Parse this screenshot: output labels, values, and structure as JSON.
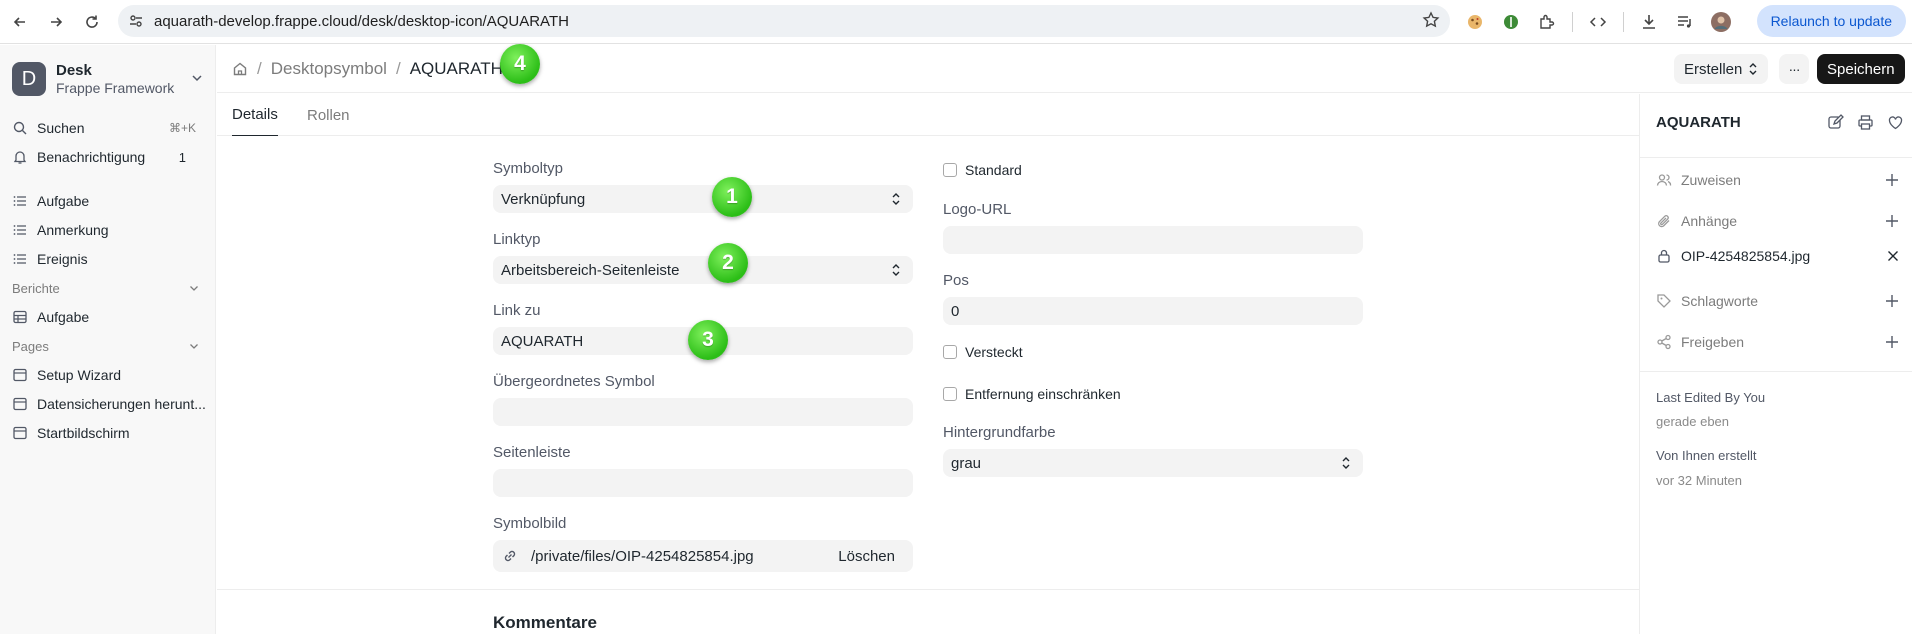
{
  "browser": {
    "url": "aquarath-develop.frappe.cloud/desk/desktop-icon/AQUARATH",
    "relaunch_label": "Relaunch to update"
  },
  "sidebar": {
    "workspace_initial": "D",
    "workspace_title": "Desk",
    "workspace_subtitle": "Frappe Framework",
    "search_label": "Suchen",
    "search_shortcut": "⌘+K",
    "notifications_label": "Benachrichtigung",
    "notifications_count": "1",
    "items": [
      {
        "label": "Aufgabe"
      },
      {
        "label": "Anmerkung"
      },
      {
        "label": "Ereignis"
      }
    ],
    "reports_section": "Berichte",
    "reports": [
      {
        "label": "Aufgabe"
      }
    ],
    "pages_section": "Pages",
    "pages": [
      {
        "label": "Setup Wizard"
      },
      {
        "label": "Datensicherungen herunt..."
      },
      {
        "label": "Startbildschirm"
      }
    ]
  },
  "header": {
    "breadcrumb_parent": "Desktopsymbol",
    "breadcrumb_current": "AQUARATH",
    "create_label": "Erstellen",
    "more_label": "···",
    "save_label": "Speichern"
  },
  "annotations": [
    "1",
    "2",
    "3",
    "4"
  ],
  "tabs": [
    {
      "label": "Details",
      "active": true
    },
    {
      "label": "Rollen",
      "active": false
    }
  ],
  "form": {
    "symboltyp_label": "Symboltyp",
    "symboltyp_value": "Verknüpfung",
    "linktyp_label": "Linktyp",
    "linktyp_value": "Arbeitsbereich-Seitenleiste",
    "linkzu_label": "Link zu",
    "linkzu_value": "AQUARATH",
    "parent_label": "Übergeordnetes Symbol",
    "parent_value": "",
    "sidebar_label": "Seitenleiste",
    "sidebar_value": "",
    "image_label": "Symbolbild",
    "image_value": "/private/files/OIP-4254825854.jpg",
    "image_delete": "Löschen",
    "standard_label": "Standard",
    "logo_label": "Logo-URL",
    "logo_value": "",
    "pos_label": "Pos",
    "pos_value": "0",
    "hidden_label": "Versteckt",
    "restrict_label": "Entfernung einschränken",
    "bg_label": "Hintergrundfarbe",
    "bg_value": "grau"
  },
  "comments_title": "Kommentare",
  "right_panel": {
    "title": "AQUARATH",
    "assign_label": "Zuweisen",
    "attachments_label": "Anhänge",
    "attachment_file": "OIP-4254825854.jpg",
    "tags_label": "Schlagworte",
    "share_label": "Freigeben",
    "last_edited": "Last Edited By You",
    "last_edited_time": "gerade eben",
    "created_by": "Von Ihnen erstellt",
    "created_time": "vor 32 Minuten"
  },
  "colors": {
    "accent_badge": "#2cbe17",
    "save_button": "#171717",
    "relaunch_bg": "#d3e3fd",
    "relaunch_text": "#0b57d0"
  }
}
